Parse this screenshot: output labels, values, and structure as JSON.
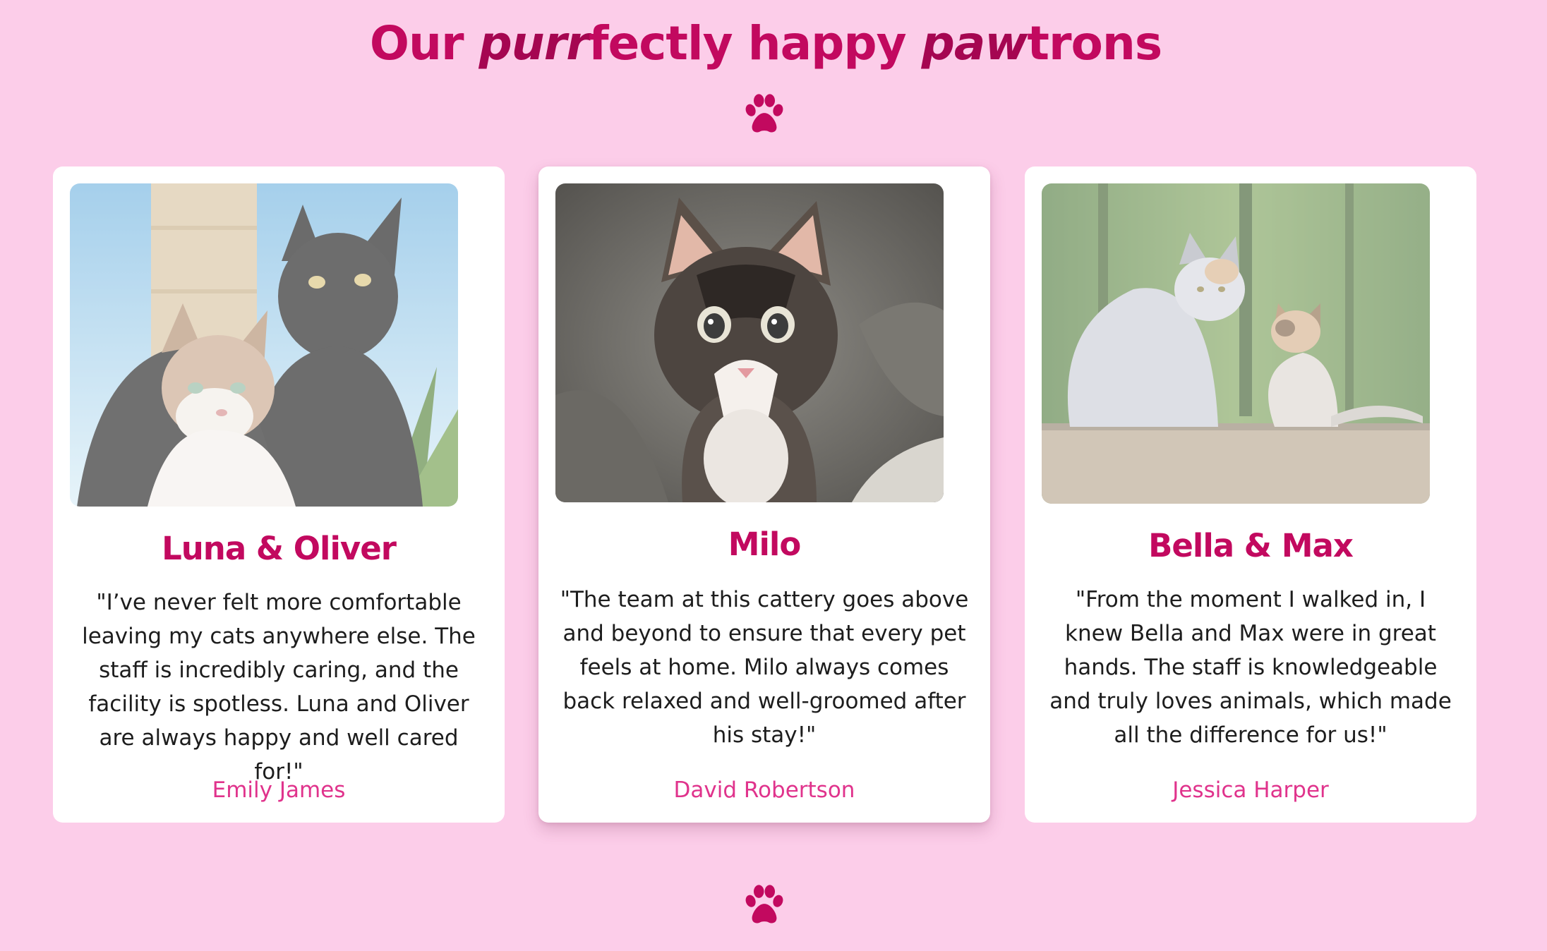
{
  "header": {
    "title_parts": [
      "Our ",
      "purr",
      "fectly happy ",
      "paw",
      "trons"
    ]
  },
  "colors": {
    "background": "#fccde9",
    "accent": "#c2095f",
    "author": "#e0338c",
    "card": "#ffffff"
  },
  "icons": {
    "top": "paw-icon",
    "bottom": "paw-icon"
  },
  "testimonials": [
    {
      "name": "Luna & Oliver",
      "quote": "\"I’ve never felt more comfortable leaving my cats anywhere else. The staff is incredibly caring, and the facility is spotless. Luna and Oliver are always happy and well cared for!\"",
      "author": "Emily James",
      "photo": "tabby cat and black cat against sky"
    },
    {
      "name": "Milo",
      "quote": "\"The team at this cattery goes above and beyond to ensure that every pet feels at home. Milo always comes back relaxed and well-groomed after his stay!\"",
      "author": "David Robertson",
      "photo": "tabby kitten on blanket"
    },
    {
      "name": "Bella & Max",
      "quote": "\"From the moment I walked in, I knew Bella and Max were in great hands. The staff is knowledgeable and truly loves animals, which made all the difference for us!\"",
      "author": "Jessica Harper",
      "photo": "fluffy cat and kitten on a wall"
    }
  ]
}
